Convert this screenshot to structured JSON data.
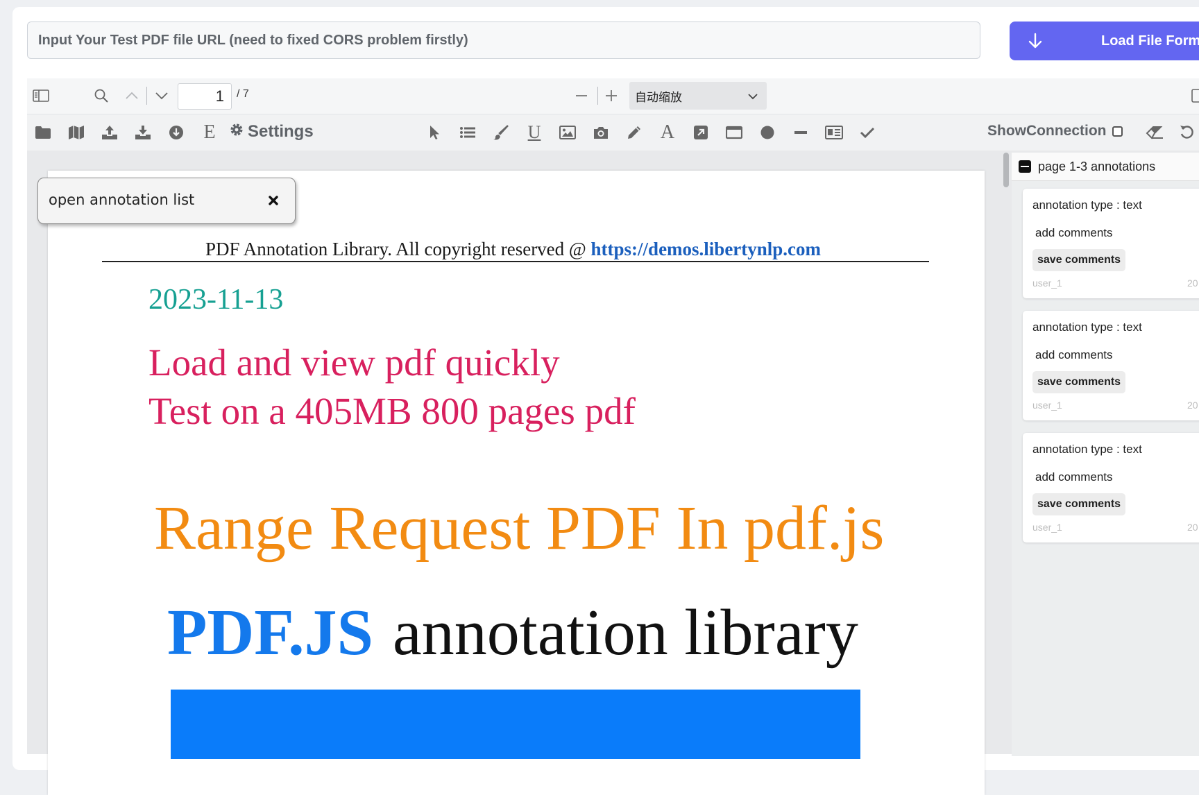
{
  "url_bar": {
    "placeholder": "Input Your Test PDF file URL (need to fixed CORS problem firstly)",
    "value": ""
  },
  "load_button": {
    "label": "Load File Form",
    "icon": "arrow-down-icon"
  },
  "viewer_toolbar": {
    "page_number": "1",
    "page_total": "/ 7",
    "zoom_value": "自动缩放"
  },
  "annotation_toolbar": {
    "settings_label": "Settings",
    "show_connection_label": "ShowConnection",
    "show_connection_checked": false
  },
  "popup": {
    "text": "open annotation list"
  },
  "pdf": {
    "header_text": "PDF Annotation Library. All copyright reserved @ ",
    "header_link": "https://demos.libertynlp.com",
    "date": "2023-11-13",
    "line1": "Load and view pdf quickly",
    "line2": "Test on a 405MB 800 pages pdf",
    "range_title": "Range Request PDF In pdf.js",
    "pdfjs_label": "PDF.JS",
    "annotation_library": "annotation library"
  },
  "annotations_panel": {
    "header": "page 1-3 annotations",
    "items": [
      {
        "type": "annotation type : text",
        "comment": "add comments",
        "save_label": "save comments",
        "user": "user_1",
        "date": "20"
      },
      {
        "type": "annotation type : text",
        "comment": "add comments",
        "save_label": "save comments",
        "user": "user_1",
        "date": "20"
      },
      {
        "type": "annotation type : text",
        "comment": "add comments",
        "save_label": "save comments",
        "user": "user_1",
        "date": "20"
      }
    ]
  },
  "colors": {
    "accent": "#6366f1",
    "date_color": "#16a092",
    "pink_text": "#d8205e",
    "orange_text": "#f28b12",
    "blue_text": "#1479ec",
    "link_color": "#1b5fbd",
    "blue_block": "#0a7cfa"
  }
}
